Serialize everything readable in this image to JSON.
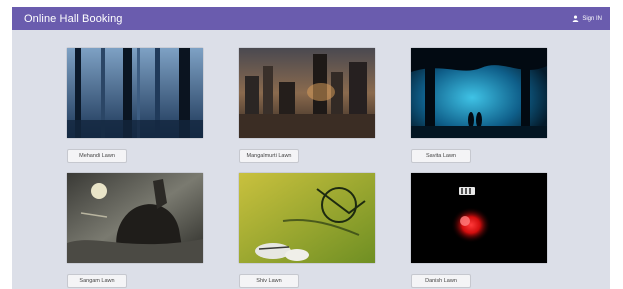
{
  "header": {
    "title": "Online Hall Booking",
    "sign_in_label": "Sign IN",
    "sign_in_icon": "user-icon",
    "color": "#6a5cae"
  },
  "halls": [
    {
      "name": "Mehandi Lawn",
      "image": "misty-forest"
    },
    {
      "name": "Mangalmurti Lawn",
      "image": "ruined-city"
    },
    {
      "name": "Savita Lawn",
      "image": "night-tree"
    },
    {
      "name": "Sangam Lawn",
      "image": "warrior-on-beast"
    },
    {
      "name": "Shiv Lawn",
      "image": "bicycle-on-grass"
    },
    {
      "name": "Danish Lawn",
      "image": "red-glow-dark"
    }
  ]
}
